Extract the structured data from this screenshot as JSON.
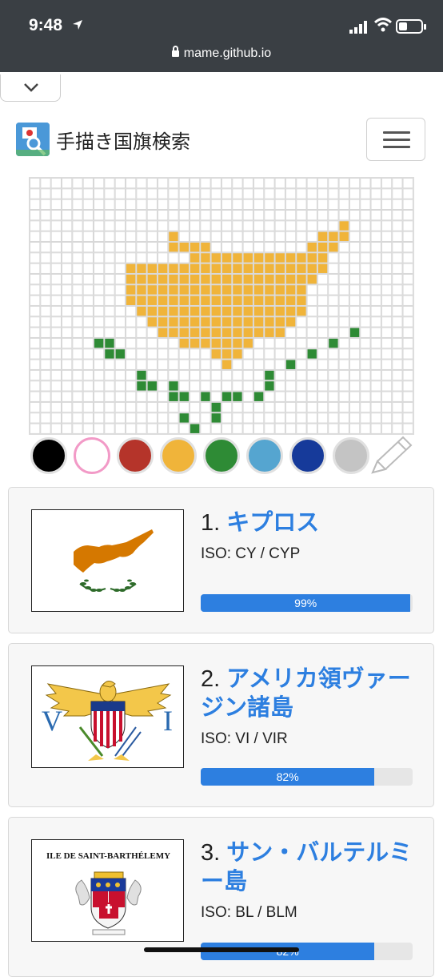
{
  "status_bar": {
    "time": "9:48",
    "url": "mame.github.io"
  },
  "app": {
    "title": "手描き国旗検索"
  },
  "palette": {
    "colors": [
      "#000000",
      "#ffffff",
      "#b5342a",
      "#f0b43a",
      "#2e8b35",
      "#55a5d0",
      "#163a9a",
      "#c4c4c4"
    ],
    "selected_index": 1
  },
  "drawing_colors": {
    "orange": "#f0b43a",
    "green": "#2e8b35"
  },
  "results": [
    {
      "rank": "1.",
      "name": "キプロス",
      "iso": "ISO: CY / CYP",
      "score": 99,
      "score_label": "99%"
    },
    {
      "rank": "2.",
      "name": "アメリカ領ヴァージン諸島",
      "iso": "ISO: VI / VIR",
      "score": 82,
      "score_label": "82%"
    },
    {
      "rank": "3.",
      "name": "サン・バルテルミー島",
      "iso": "ISO: BL / BLM",
      "score": 82,
      "score_label": "82%",
      "flag_text": "ILE DE SAINT-BARTHÉLEMY"
    }
  ],
  "vi_flag": {
    "left_letter": "V",
    "right_letter": "I"
  }
}
